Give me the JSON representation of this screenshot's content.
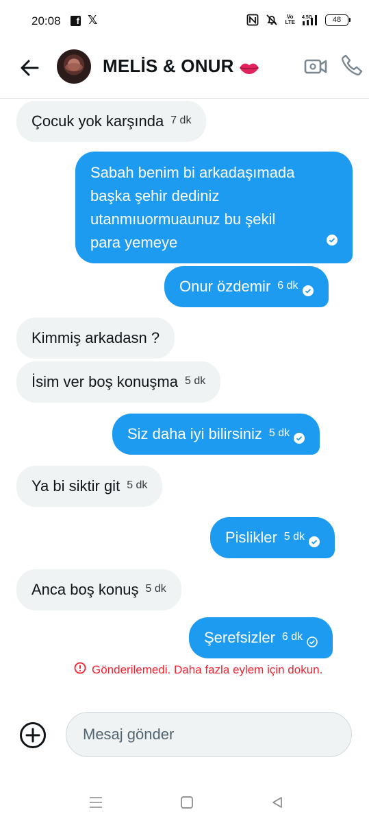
{
  "status_bar": {
    "time": "20:08",
    "notification_icons": [
      "facebook-icon",
      "x-icon"
    ],
    "system_icons": [
      "nfc-icon",
      "mute-icon",
      "volte-icon",
      "signal-icon"
    ],
    "volte_text": "Vo LTE",
    "network": "4.5G",
    "battery": "48"
  },
  "header": {
    "back_icon": "arrow-left-icon",
    "title": "MELİS & ONUR",
    "title_emoji": "lips-icon",
    "video_icon": "video-camera-icon",
    "call_icon": "phone-icon"
  },
  "messages": [
    {
      "id": 0,
      "direction": "in",
      "text": "Çocuk yok karşında",
      "time": "7 dk"
    },
    {
      "id": 1,
      "direction": "out",
      "lines": [
        "Sabah benim bi arkadaşımada",
        "başka şehir dediniz",
        "utanmıuormuaunuz bu şekil",
        "para yemeye"
      ],
      "status": "read"
    },
    {
      "id": 2,
      "direction": "out",
      "text": "Onur özdemir",
      "time": "6 dk",
      "status": "read"
    },
    {
      "id": 3,
      "direction": "in",
      "text": "Kimmiş arkadasn ?"
    },
    {
      "id": 4,
      "direction": "in",
      "text": "İsim ver boş konuşma",
      "time": "5 dk"
    },
    {
      "id": 5,
      "direction": "out",
      "text": "Siz daha iyi bilirsiniz",
      "time": "5 dk",
      "status": "read"
    },
    {
      "id": 6,
      "direction": "in",
      "text": "Ya bi siktir git",
      "time": "5 dk"
    },
    {
      "id": 7,
      "direction": "out",
      "text": "Pislikler",
      "time": "5 dk",
      "status": "read"
    },
    {
      "id": 8,
      "direction": "in",
      "text": "Anca boş konuş",
      "time": "5 dk"
    },
    {
      "id": 9,
      "direction": "out",
      "text": "Şerefsizler",
      "time": "6 dk",
      "status": "sent"
    }
  ],
  "error": {
    "text": "Gönderilemedi. Daha fazla eylem için dokun.",
    "icon": "alert-circle-icon"
  },
  "composer": {
    "add_icon": "plus-circle-icon",
    "placeholder": "Mesaj gönder"
  },
  "nav_bar": {
    "icons": [
      "menu-icon",
      "home-square-icon",
      "back-triangle-icon"
    ]
  },
  "colors": {
    "outgoing_bubble": "#1d9bf0",
    "incoming_bubble": "#eff3f4",
    "error": "#f4212e",
    "text": "#0f1419"
  }
}
